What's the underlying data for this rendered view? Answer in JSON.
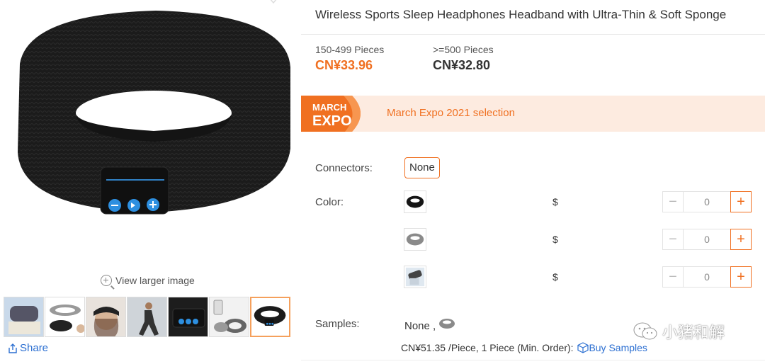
{
  "gallery": {
    "main_image_alt": "black knitted headband headphones",
    "view_larger_label": "View larger image",
    "share_label": "Share",
    "thumbnails": [
      "thumb-1",
      "thumb-2",
      "thumb-3",
      "thumb-4",
      "thumb-5",
      "thumb-6",
      "thumb-7"
    ],
    "active_thumbnail": 7
  },
  "product": {
    "title": "Wireless Sports Sleep Headphones Headband with Ultra-Thin & Soft Sponge",
    "tiers": [
      {
        "range": "150-499 Pieces",
        "price": "CN¥33.96"
      },
      {
        "range": ">=500 Pieces",
        "price": "CN¥32.80"
      }
    ]
  },
  "expo": {
    "badge_line1": "MARCH",
    "badge_line2": "EXPO",
    "text": "March Expo 2021 selection"
  },
  "options": {
    "connectors_label": "Connectors:",
    "connectors_value": "None",
    "color_label": "Color:",
    "colors": [
      {
        "swatch": "black-headband",
        "price": "$",
        "qty": "0"
      },
      {
        "swatch": "gray-headband",
        "price": "$",
        "qty": "0"
      },
      {
        "swatch": "packaged-headband",
        "price": "$",
        "qty": "0"
      }
    ],
    "minus_symbol": "−",
    "plus_symbol": "+"
  },
  "samples": {
    "label": "Samples:",
    "value": "None ,",
    "price_text": "CN¥51.35 /Piece, 1 Piece (Min. Order):",
    "buy_label": "Buy Samples"
  },
  "watermark": "小猪和解",
  "colors": {
    "accent": "#f07021",
    "link": "#2a6ed1",
    "banner_bg": "#fdebe0"
  }
}
